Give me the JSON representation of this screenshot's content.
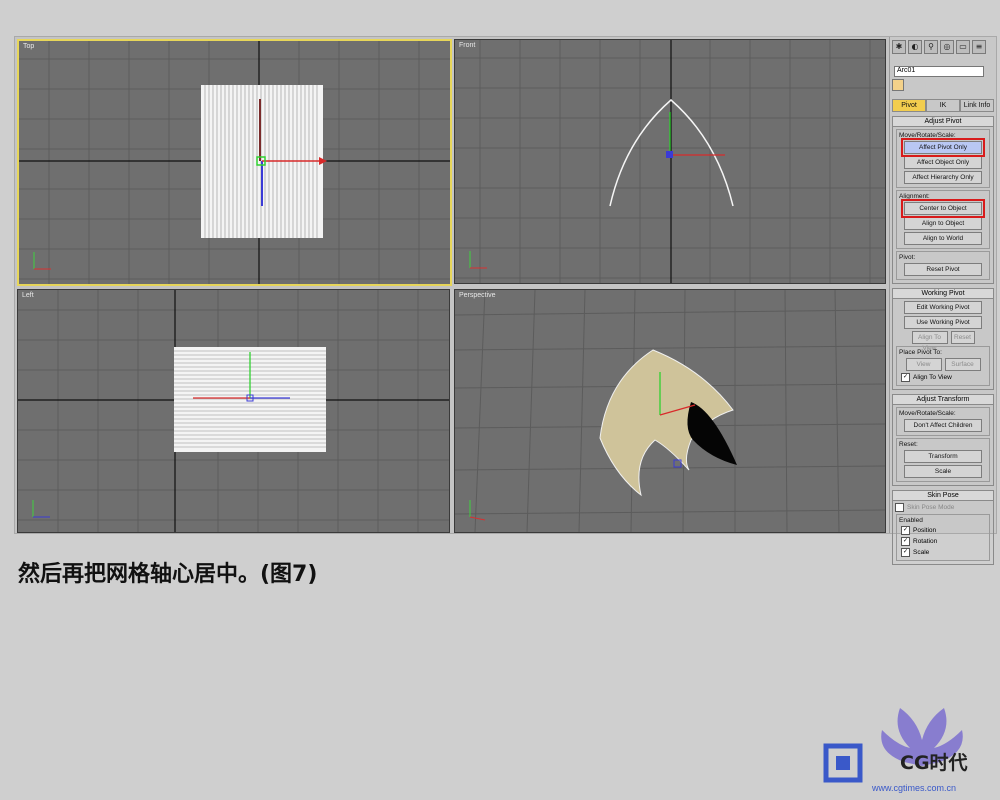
{
  "viewports": {
    "top": "Top",
    "front": "Front",
    "left": "Left",
    "perspective": "Perspective"
  },
  "command_panel": {
    "object_name": "Arc01",
    "tabs": [
      "Pivot",
      "IK",
      "Link Info"
    ],
    "adjust_pivot": {
      "title": "Adjust Pivot",
      "move_group": "Move/Rotate/Scale:",
      "affect_pivot_only": "Affect Pivot Only",
      "affect_object_only": "Affect Object Only",
      "affect_hierarchy_only": "Affect Hierarchy Only",
      "alignment_group": "Alignment:",
      "center_to_object": "Center to Object",
      "align_to_object": "Align to Object",
      "align_to_world": "Align to World",
      "pivot_group": "Pivot:",
      "reset_pivot": "Reset Pivot"
    },
    "working_pivot": {
      "title": "Working Pivot",
      "edit": "Edit Working Pivot",
      "use": "Use Working Pivot",
      "align_to_view": "Align To View",
      "reset": "Reset",
      "place_group": "Place Pivot To:",
      "view": "View",
      "surface": "Surface",
      "align_to_view_chk": "Align To View"
    },
    "adjust_transform": {
      "title": "Adjust Transform",
      "move_group": "Move/Rotate/Scale:",
      "dont_affect": "Don't Affect Children",
      "reset_group": "Reset:",
      "transform": "Transform",
      "scale": "Scale"
    },
    "skin_pose": {
      "title": "Skin Pose",
      "mode": "Skin Pose Mode",
      "enabled_group": "Enabled",
      "position": "Position",
      "rotation": "Rotation",
      "scale": "Scale"
    }
  },
  "caption": "然后再把网格轴心居中。(图7)",
  "logo": {
    "text": "CG时代",
    "url": "www.cgtimes.com.cn"
  },
  "colors": {
    "viewport_bg": "#6f6f6f",
    "active_border": "#e7d65a",
    "highlight": "#d81b1b",
    "selected_tab": "#f2cd4e"
  }
}
